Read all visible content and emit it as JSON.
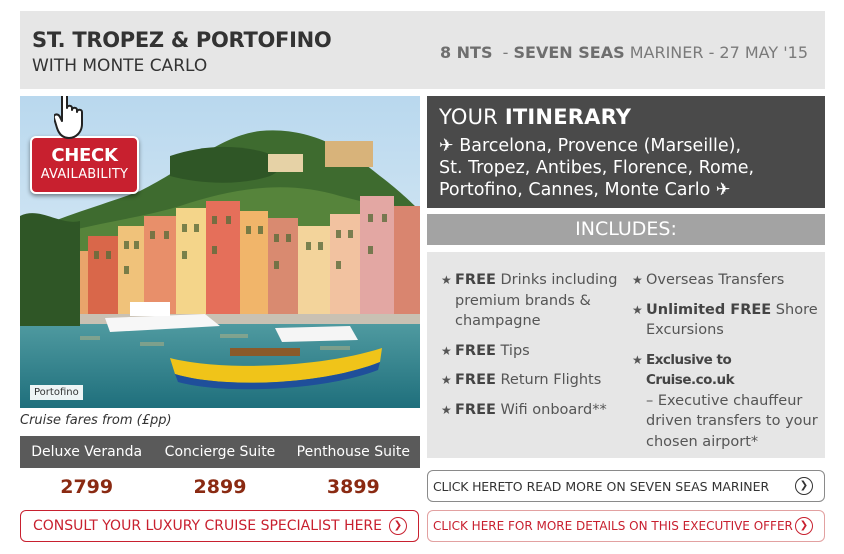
{
  "header": {
    "title": "ST. TROPEZ & PORTOFINO",
    "subtitle": "WITH MONTE CARLO",
    "nights": "8 NTS",
    "ship": "SEVEN SEAS",
    "ship_rest": "MARINER - 27 MAY '15"
  },
  "photo": {
    "caption": "Portofino",
    "check_line1": "CHECK",
    "check_line2": "AVAILABILITY"
  },
  "fares": {
    "label": "Cruise fares from (£pp)",
    "columns": [
      "Deluxe Veranda",
      "Concierge Suite",
      "Penthouse Suite"
    ],
    "prices": [
      "2799",
      "2899",
      "3899"
    ]
  },
  "consult_button": "CONSULT YOUR LUXURY CRUISE SPECIALIST HERE",
  "itinerary": {
    "heading_light": "YOUR",
    "heading_bold": "ITINERARY",
    "line1": "✈ Barcelona, Provence (Marseille),",
    "line2": "St. Tropez, Antibes, Florence, Rome,",
    "line3": "Portofino, Cannes, Monte Carlo  ✈"
  },
  "includes": {
    "heading": "INCLUDES:",
    "col1": [
      {
        "bold": "FREE",
        "text": " Drinks including premium brands & champagne"
      },
      {
        "bold": "FREE",
        "text": " Tips"
      },
      {
        "bold": "FREE",
        "text": " Return Flights"
      },
      {
        "bold": "FREE",
        "text": " Wifi onboard**"
      }
    ],
    "col2": [
      {
        "bold": "",
        "text": "Overseas Transfers"
      },
      {
        "bold": "Unlimited FREE",
        "text": " Shore Excursions"
      },
      {
        "bold": "Exclusive to Cruise.co.uk",
        "text": ""
      },
      {
        "bold": "",
        "text": "– Executive chauffeur driven transfers to your chosen airport*"
      }
    ]
  },
  "links": {
    "read_more_bold": "CLICK HERE",
    "read_more_rest": " TO READ MORE ON SEVEN SEAS MARINER",
    "offer": "CLICK HERE FOR MORE DETAILS ON THIS EXECUTIVE OFFER"
  },
  "colors": {
    "brand_red": "#c8202f",
    "price_color": "#8a2a12",
    "itinerary_bg": "#4a4a4a",
    "includes_bar": "#a3a3a3"
  },
  "icons": [
    "airplane-icon",
    "star-icon",
    "pointing-hand-icon",
    "circle-arrow-icon"
  ]
}
